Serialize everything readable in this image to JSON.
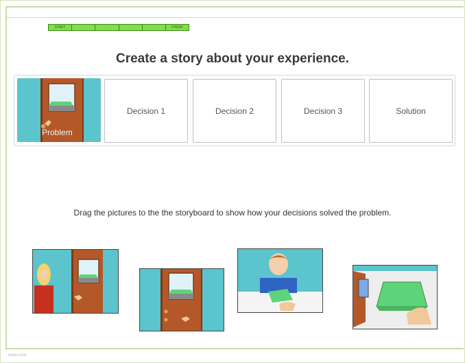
{
  "progress": {
    "start_label": "START",
    "finish_label": "FINISH",
    "segments": 6
  },
  "title": "Create a story about your experience.",
  "storyboard": {
    "slots": [
      {
        "label": "Problem",
        "filled": true
      },
      {
        "label": "Decision 1",
        "filled": false
      },
      {
        "label": "Decision 2",
        "filled": false
      },
      {
        "label": "Decision 3",
        "filled": false
      },
      {
        "label": "Solution",
        "filled": false
      }
    ]
  },
  "instruction": "Drag the pictures to the the storyboard to show how your decisions solved the problem.",
  "pictures": [
    {
      "icon": "woman-at-door-picture"
    },
    {
      "icon": "door-with-key-picture"
    },
    {
      "icon": "clerk-at-counter-picture"
    },
    {
      "icon": "hand-on-box-picture"
    }
  ],
  "colors": {
    "accent": "#c9dca8",
    "progress": "#7fe04a",
    "scene": "#5cc4cc",
    "door": "#b4582a",
    "box": "#66cc77"
  },
  "footer": "Reflex 2009"
}
